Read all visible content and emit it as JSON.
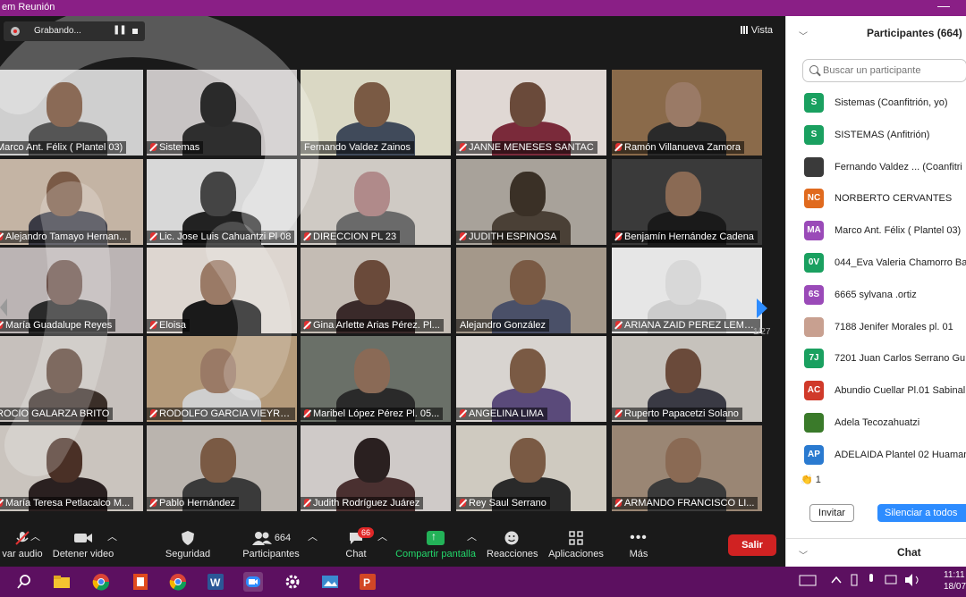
{
  "window": {
    "title": "em Reunión",
    "minimize": "—"
  },
  "recording": {
    "label": "Grabando...",
    "pause": "❚❚"
  },
  "view": {
    "label": "Vista"
  },
  "tiles": [
    {
      "name": "Marco Ant. Félix ( Plantel 03)",
      "muted": false,
      "active": false,
      "bg": "#cfcfcf",
      "skin": "#8a6a56",
      "shirt": "#555"
    },
    {
      "name": "Sistemas",
      "muted": true,
      "active": false,
      "bg": "#c8c4c4",
      "skin": "#2a2a2a",
      "shirt": "#2e2e2e"
    },
    {
      "name": "Fernando Valdez Zainos",
      "muted": false,
      "active": true,
      "bg": "#dad8c4",
      "skin": "#7a5a44",
      "shirt": "#404a5a"
    },
    {
      "name": "JANNE MENESES SANTAC",
      "muted": true,
      "active": false,
      "bg": "#e0d8d4",
      "skin": "#6a4a3a",
      "shirt": "#7a2a3a"
    },
    {
      "name": "Ramón Villanueva Zamora",
      "muted": true,
      "active": false,
      "bg": "#8a6a4a",
      "skin": "#9a7a66",
      "shirt": "#2a2a2a"
    },
    {
      "name": "Alejandro Tamayo Hernan...",
      "muted": true,
      "active": false,
      "bg": "#c4b4a4",
      "skin": "#7a5a46",
      "shirt": "#3a3a44"
    },
    {
      "name": "Lic. Jose Luis Cahuantzi Pl 08",
      "muted": true,
      "active": false,
      "bg": "#d8d8d8",
      "skin": "#444",
      "shirt": "#222"
    },
    {
      "name": "DIRECCION PL 23",
      "muted": true,
      "active": false,
      "bg": "#cfcac4",
      "skin": "#b08a8a",
      "shirt": "#6a6a6a"
    },
    {
      "name": "JUDITH ESPINOSA",
      "muted": true,
      "active": false,
      "bg": "#a8a29a",
      "skin": "#3a3026",
      "shirt": "#4a4036"
    },
    {
      "name": "Benjamín Hernández Cadena",
      "muted": true,
      "active": false,
      "bg": "#3a3a3a",
      "skin": "#8a6a54",
      "shirt": "#1a1a1a"
    },
    {
      "name": "María Guadalupe Reyes",
      "muted": true,
      "active": false,
      "bg": "#bbb4b4",
      "skin": "#6a5048",
      "shirt": "#2a2a2a"
    },
    {
      "name": "Eloisa",
      "muted": true,
      "active": false,
      "bg": "#ddd6d0",
      "skin": "#9a7a66",
      "shirt": "#1a1a1a"
    },
    {
      "name": "Gina Arlette Arias Pérez. Pl...",
      "muted": true,
      "active": false,
      "bg": "#c4bcb4",
      "skin": "#6a4a3a",
      "shirt": "#3a2a2a"
    },
    {
      "name": "Alejandro González",
      "muted": false,
      "active": false,
      "bg": "#a4988a",
      "skin": "#7a5a44",
      "shirt": "#4a5068"
    },
    {
      "name": "ARIANA ZAID PEREZ LEMO...",
      "muted": true,
      "active": false,
      "bg": "#e6e6e6",
      "skin": "#d8d8d8",
      "shirt": "#cccccc"
    },
    {
      "name": "ROCIO GALARZA BRITO",
      "muted": false,
      "active": false,
      "bg": "#c6c0bc",
      "skin": "#5a4034",
      "shirt": "#3a2e28"
    },
    {
      "name": "RODOLFO GARCIA VIEYRA ...",
      "muted": true,
      "active": false,
      "bg": "#b49a7a",
      "skin": "#9a7a66",
      "shirt": "#cfcfcf"
    },
    {
      "name": "Maribel López Pérez Pl. 05...",
      "muted": true,
      "active": false,
      "bg": "#6a7068",
      "skin": "#8a6a56",
      "shirt": "#2a2a2a"
    },
    {
      "name": "ANGELINA LIMA",
      "muted": true,
      "active": false,
      "bg": "#d8d4d0",
      "skin": "#7a5a44",
      "shirt": "#5a4a7a"
    },
    {
      "name": "Ruperto Papacetzi Solano",
      "muted": true,
      "active": false,
      "bg": "#c6c2bc",
      "skin": "#6a4a3a",
      "shirt": "#3a3a44"
    },
    {
      "name": "María Teresa Petlacalco M...",
      "muted": true,
      "active": false,
      "bg": "#cac4be",
      "skin": "#4a3026",
      "shirt": "#2a2020"
    },
    {
      "name": "Pablo Hernández",
      "muted": true,
      "active": false,
      "bg": "#bab4ae",
      "skin": "#7a5a44",
      "shirt": "#3a3a3a"
    },
    {
      "name": "Judith Rodríguez Juárez",
      "muted": true,
      "active": false,
      "bg": "#cfcac8",
      "skin": "#2a2020",
      "shirt": "#4a3030"
    },
    {
      "name": "Rey Saul Serrano",
      "muted": true,
      "active": false,
      "bg": "#cfcac0",
      "skin": "#7a5a44",
      "shirt": "#2a2a2a"
    },
    {
      "name": "ARMANDO FRANCISCO LI...",
      "muted": true,
      "active": false,
      "bg": "#9a8674",
      "skin": "#8a6a54",
      "shirt": "#3a3a3a"
    }
  ],
  "pager": {
    "page": "1/27"
  },
  "toolbar": {
    "audio": "var audio",
    "video": "Detener video",
    "security": "Seguridad",
    "participants_count": "664",
    "participants": "Participantes",
    "chat_badge": "66",
    "chat": "Chat",
    "share": "Compartir pantalla",
    "reactions": "Reacciones",
    "apps": "Aplicaciones",
    "more": "Más",
    "leave": "Salir"
  },
  "panel": {
    "title": "Participantes (664)",
    "search_placeholder": "Buscar un participante",
    "participants": [
      {
        "initials": "S",
        "name": "Sistemas (Coanfitrión, yo)",
        "color": "#1aa060"
      },
      {
        "initials": "S",
        "name": "SISTEMAS (Anfitrión)",
        "color": "#1aa060"
      },
      {
        "initials": "",
        "name": "Fernando Valdez ...   (Coanfitri",
        "color": "#3a3a3a"
      },
      {
        "initials": "NC",
        "name": "NORBERTO CERVANTES",
        "color": "#e06a1e"
      },
      {
        "initials": "MA",
        "name": "Marco Ant. Félix ( Plantel 03)",
        "color": "#9a4ab8"
      },
      {
        "initials": "0V",
        "name": "044_Eva Valeria Chamorro Ba",
        "color": "#1aa060"
      },
      {
        "initials": "6S",
        "name": "6665 sylvana .ortiz",
        "color": "#9a4ab8"
      },
      {
        "initials": "",
        "name": "7188 Jenifer Morales pl. 01",
        "color": "#c8a090"
      },
      {
        "initials": "7J",
        "name": "7201 Juan Carlos Serrano Gu",
        "color": "#1aa060"
      },
      {
        "initials": "AC",
        "name": "Abundio Cuellar Pl.01 Sabinal",
        "color": "#d03a2a"
      },
      {
        "initials": "",
        "name": "Adela Tecozahuatzi",
        "color": "#3a7a2a"
      },
      {
        "initials": "AP",
        "name": "ADELAIDA Plantel 02 Huaman",
        "color": "#2a7ad0"
      }
    ],
    "reaction": "👏 1",
    "invite": "Invitar",
    "mute_all": "Silenciar a todos",
    "chat_title": "Chat"
  },
  "taskbar": {
    "time": "11:11",
    "date": "18/07"
  }
}
